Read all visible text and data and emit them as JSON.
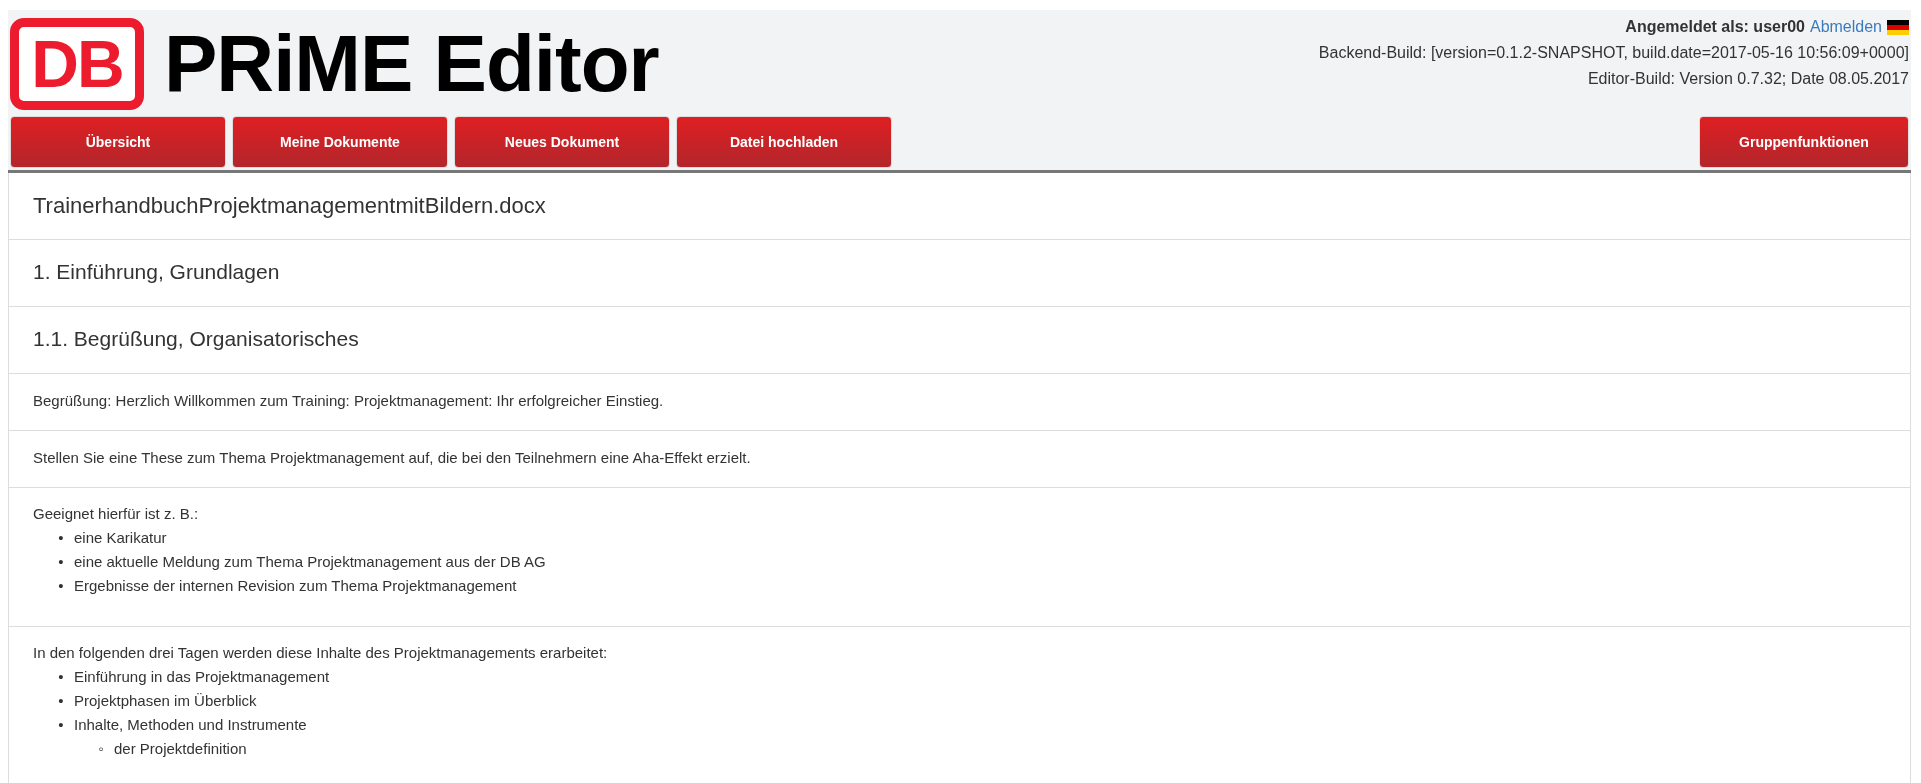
{
  "header": {
    "logo_text": "DB",
    "title": "PRiME Editor",
    "login_label": "Angemeldet als: user00",
    "logout_link": "Abmelden",
    "backend_build": "Backend-Build: [version=0.1.2-SNAPSHOT, build.date=2017-05-16 10:56:09+0000]",
    "editor_build": "Editor-Build: Version 0.7.32; Date 08.05.2017"
  },
  "nav_left": [
    {
      "label": "Übersicht"
    },
    {
      "label": "Meine Dokumente"
    },
    {
      "label": "Neues Dokument"
    },
    {
      "label": "Datei hochladen"
    }
  ],
  "nav_right": [
    {
      "label": "Gruppenfunktionen"
    }
  ],
  "blocks": [
    {
      "kind": "title",
      "text": "TrainerhandbuchProjektmanagementmitBildern.docx"
    },
    {
      "kind": "heading",
      "text": "1. Einführung, Grundlagen"
    },
    {
      "kind": "heading",
      "text": "1.1. Begrüßung, Organisatorisches"
    },
    {
      "kind": "paragraph",
      "text": "Begrüßung: Herzlich Willkommen zum Training: Projektmanagement: Ihr erfolgreicher Einstieg."
    },
    {
      "kind": "paragraph",
      "text": "Stellen Sie eine These zum Thema Projektmanagement auf, die bei den Teilnehmern eine Aha-Effekt erzielt."
    },
    {
      "kind": "list",
      "text": "Geeignet hierfür ist z. B.:",
      "items": [
        {
          "marker": "•",
          "text": "eine Karikatur"
        },
        {
          "marker": "•",
          "text": "eine aktuelle Meldung zum Thema Projektmanagement aus der DB AG"
        },
        {
          "marker": "•",
          "text": "Ergebnisse der internen Revision zum Thema Projektmanagement"
        }
      ]
    },
    {
      "kind": "list",
      "text": "In den folgenden drei Tagen werden diese Inhalte des Projektmanagements erarbeitet:",
      "items": [
        {
          "marker": "•",
          "text": "Einführung in das Projektmanagement"
        },
        {
          "marker": "•",
          "text": "Projektphasen im Überblick"
        },
        {
          "marker": "•",
          "text": "Inhalte, Methoden und Instrumente",
          "children": [
            {
              "marker": "◦",
              "text": "der Projektdefinition"
            }
          ]
        }
      ]
    }
  ]
}
